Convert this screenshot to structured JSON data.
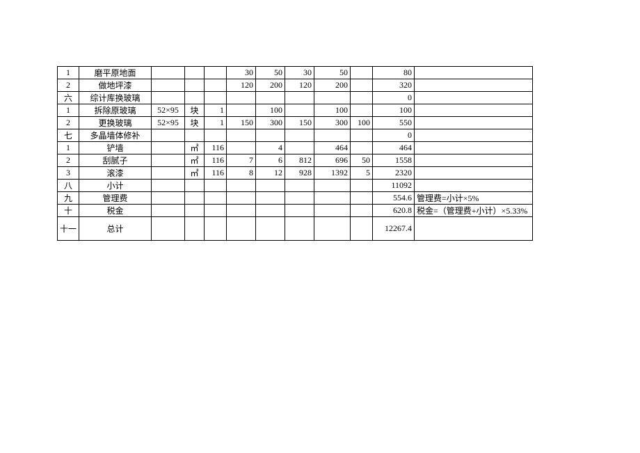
{
  "rows": [
    {
      "idx": "1",
      "name": "磨平原地面",
      "spec": "",
      "unit": "",
      "qty": "",
      "u1": "30",
      "u2": "50",
      "u3": "30",
      "u4": "50",
      "u5": "",
      "total": "80",
      "note": ""
    },
    {
      "idx": "2",
      "name": "做地坪漆",
      "spec": "",
      "unit": "",
      "qty": "",
      "u1": "120",
      "u2": "200",
      "u3": "120",
      "u4": "200",
      "u5": "",
      "total": "320",
      "note": ""
    },
    {
      "idx": "六",
      "name": "综计库换玻璃",
      "spec": "",
      "unit": "",
      "qty": "",
      "u1": "",
      "u2": "",
      "u3": "",
      "u4": "",
      "u5": "",
      "total": "0",
      "note": ""
    },
    {
      "idx": "1",
      "name": "拆除原玻璃",
      "spec": "52×95",
      "unit": "块",
      "qty": "1",
      "u1": "",
      "u2": "100",
      "u3": "",
      "u4": "100",
      "u5": "",
      "total": "100",
      "note": ""
    },
    {
      "idx": "2",
      "name": "更换玻璃",
      "spec": "52×95",
      "unit": "块",
      "qty": "1",
      "u1": "150",
      "u2": "300",
      "u3": "150",
      "u4": "300",
      "u5": "100",
      "total": "550",
      "note": ""
    },
    {
      "idx": "七",
      "name": "多晶墙体修补",
      "spec": "",
      "unit": "",
      "qty": "",
      "u1": "",
      "u2": "",
      "u3": "",
      "u4": "",
      "u5": "",
      "total": "0",
      "note": ""
    },
    {
      "idx": "1",
      "name": "铲墙",
      "spec": "",
      "unit": "㎡",
      "qty": "116",
      "u1": "",
      "u2": "4",
      "u3": "",
      "u4": "464",
      "u5": "",
      "total": "464",
      "note": ""
    },
    {
      "idx": "2",
      "name": "刮腻子",
      "spec": "",
      "unit": "㎡",
      "qty": "116",
      "u1": "7",
      "u2": "6",
      "u3": "812",
      "u4": "696",
      "u5": "50",
      "total": "1558",
      "note": ""
    },
    {
      "idx": "3",
      "name": "滚漆",
      "spec": "",
      "unit": "㎡",
      "qty": "116",
      "u1": "8",
      "u2": "12",
      "u3": "928",
      "u4": "1392",
      "u5": "5",
      "total": "2320",
      "note": ""
    },
    {
      "idx": "八",
      "name": "小计",
      "spec": "",
      "unit": "",
      "qty": "",
      "u1": "",
      "u2": "",
      "u3": "",
      "u4": "",
      "u5": "",
      "total": "11092",
      "note": ""
    },
    {
      "idx": "九",
      "name": "管理费",
      "spec": "",
      "unit": "",
      "qty": "",
      "u1": "",
      "u2": "",
      "u3": "",
      "u4": "",
      "u5": "",
      "total": "554.6",
      "note": "管理费=小计×5%"
    },
    {
      "idx": "十",
      "name": "税金",
      "spec": "",
      "unit": "",
      "qty": "",
      "u1": "",
      "u2": "",
      "u3": "",
      "u4": "",
      "u5": "",
      "total": "620.8",
      "note": "税金=（管理费+小计）×5.33%"
    },
    {
      "idx": "十一",
      "name": "总计",
      "spec": "",
      "unit": "",
      "qty": "",
      "u1": "",
      "u2": "",
      "u3": "",
      "u4": "",
      "u5": "",
      "total": "12267.4",
      "note": "",
      "tall": true
    }
  ]
}
